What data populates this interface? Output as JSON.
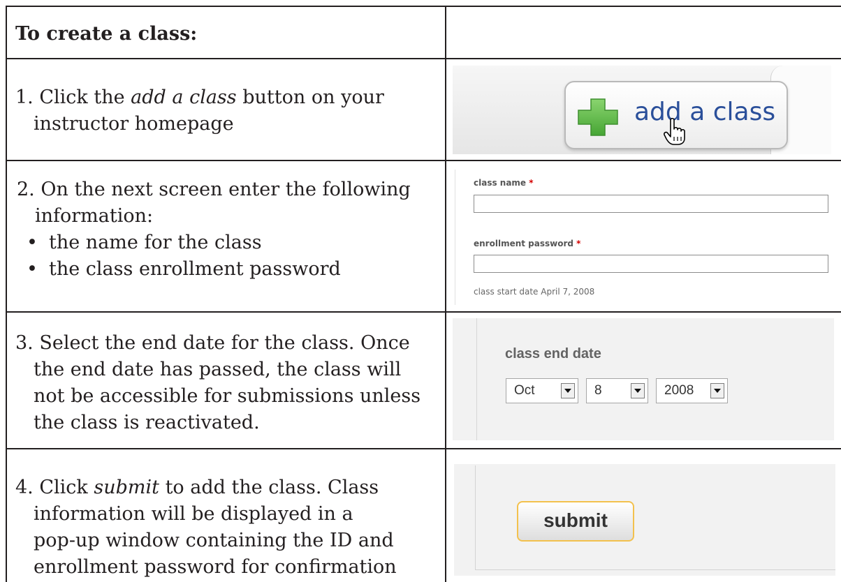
{
  "header": {
    "title": "To create a class:"
  },
  "steps": [
    {
      "number": "1.",
      "before": "Click the ",
      "italic": "add a class",
      "after_line1": " button on your",
      "line2": "instructor homepage"
    },
    {
      "line1": "2. On the next screen enter the following",
      "line2": "information:",
      "bullets": [
        "the name for the class",
        "the class enrollment password"
      ]
    },
    {
      "lines": [
        "3. Select the end date for the class. Once",
        "the end date has passed, the class will",
        "not be accessible for submissions unless",
        "the class is reactivated."
      ]
    },
    {
      "number": "4.",
      "before": "Click ",
      "italic": "submit",
      "after_line1": " to add the class. Class",
      "lines": [
        "information will be displayed in a",
        "pop-up window containing the ID and",
        "enrollment password for confirmation"
      ]
    }
  ],
  "shot1": {
    "button_label": "add a class",
    "plus_icon": "green-plus-icon",
    "cursor_icon": "hand-cursor-icon"
  },
  "shot2": {
    "class_name_label": "class name",
    "password_label": "enrollment password",
    "required_mark": "*",
    "class_name_value": "",
    "password_value": "",
    "start_date_text": "class start date April 7, 2008"
  },
  "shot3": {
    "label": "class end date",
    "month": "Oct",
    "day": "8",
    "year": "2008"
  },
  "shot4": {
    "submit_label": "submit"
  },
  "colors": {
    "border": "#231f20",
    "link_blue": "#2a4f9a",
    "plus_green": "#5cb845",
    "required_red": "#d40000",
    "submit_border": "#f3c14d"
  }
}
